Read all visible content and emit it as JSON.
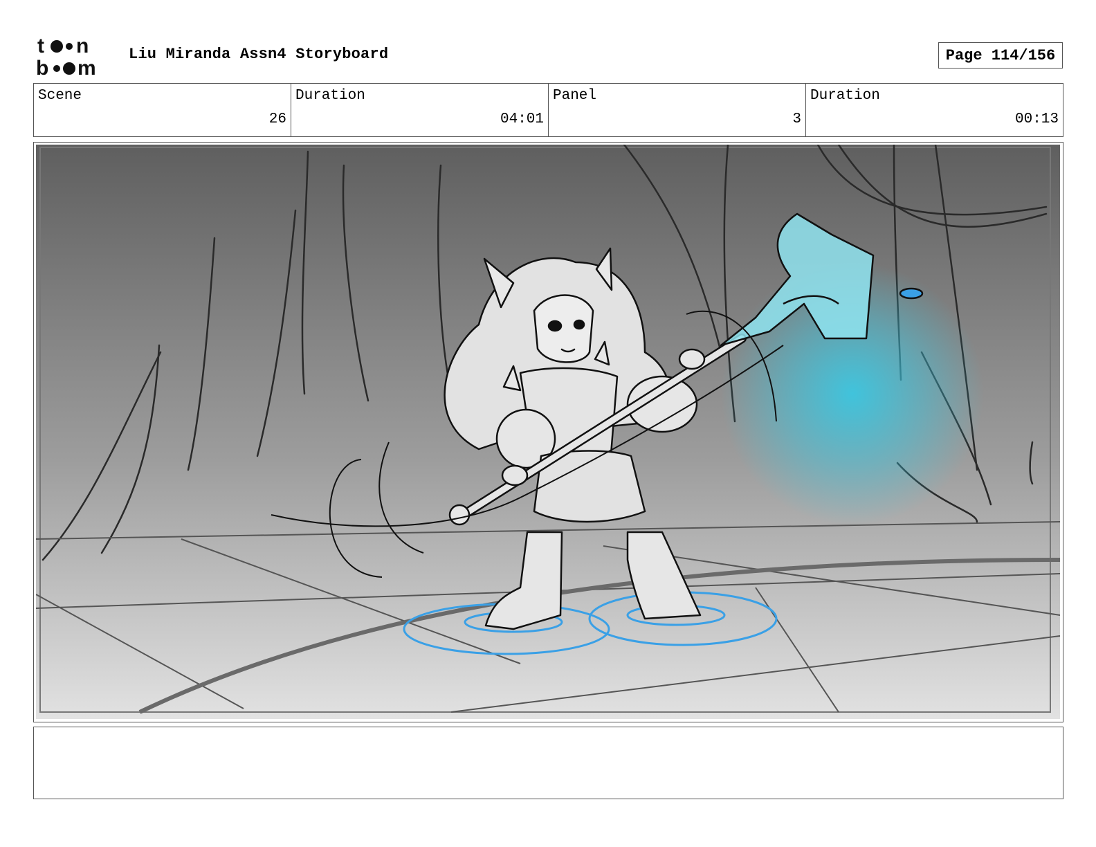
{
  "header": {
    "logo": {
      "icon": "toonboom-logo",
      "line1": "toon",
      "line2": "boom"
    },
    "title": "Liu Miranda Assn4 Storyboard",
    "page": "Page 114/156"
  },
  "info": {
    "scene_label": "Scene",
    "scene_value": "26",
    "scene_duration_label": "Duration",
    "scene_duration_value": "04:01",
    "panel_label": "Panel",
    "panel_value": "3",
    "panel_duration_label": "Duration",
    "panel_duration_value": "00:13"
  },
  "panel": {
    "image": "storyboard-sketch",
    "colors": {
      "background_top": "#5f5f5f",
      "background_bottom": "#e2e2e2",
      "glow": "#3cc6e0",
      "ripple": "#3aa0e6"
    }
  },
  "notes": {
    "text": ""
  }
}
